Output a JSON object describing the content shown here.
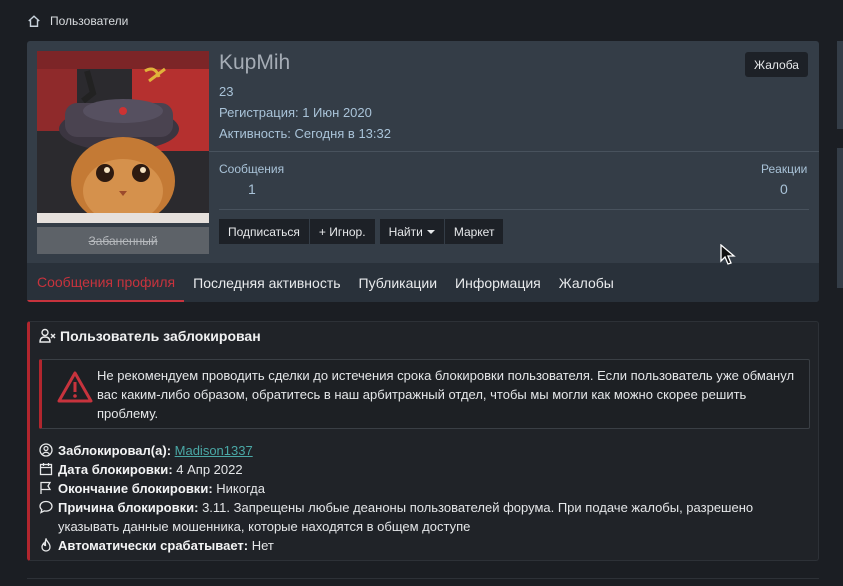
{
  "breadcrumb": {
    "label": "Пользователи"
  },
  "profile": {
    "username": "KupMih",
    "user_number": "23",
    "registration": "Регистрация: 1 Июн 2020",
    "activity": "Активность: Сегодня в 13:32",
    "banned_label": "Забаненный",
    "report_button": "Жалоба",
    "stats": {
      "messages_label": "Сообщения",
      "messages_value": "1",
      "reactions_label": "Реакции",
      "reactions_value": "0"
    },
    "buttons": {
      "subscribe": "Подписаться",
      "ignore": "+ Игнор.",
      "find": "Найти",
      "market": "Маркет"
    },
    "tabs": [
      {
        "label": "Сообщения профиля",
        "active": true
      },
      {
        "label": "Последняя активность"
      },
      {
        "label": "Публикации"
      },
      {
        "label": "Информация"
      },
      {
        "label": "Жалобы"
      }
    ]
  },
  "ban": {
    "title": "Пользователь заблокирован",
    "warning": "Не рекомендуем проводить сделки до истечения срока блокировки пользователя. Если пользователь уже обманул вас каким-либо образом, обратитесь в наш арбитражный отдел, чтобы мы могли как можно скорее решить проблему.",
    "banned_by_label": "Заблокировал(а)",
    "banned_by_value": "Madison1337",
    "date_label": "Дата блокировки",
    "date_value": "4 Апр 2022",
    "end_label": "Окончание блокировки",
    "end_value": "Никогда",
    "reason_label": "Причина блокировки",
    "reason_value": "3.11. Запрещены любые деаноны пользователей форума. При подаче жалобы, разрешено указывать данные мошенника, которые находятся в общем доступе",
    "auto_label": "Автоматически срабатывает:",
    "auto_value": "Нет"
  },
  "colors": {
    "accent": "#c7333d",
    "link": "#4aa8a6",
    "panel": "#343d47",
    "background": "#1b1e23"
  }
}
